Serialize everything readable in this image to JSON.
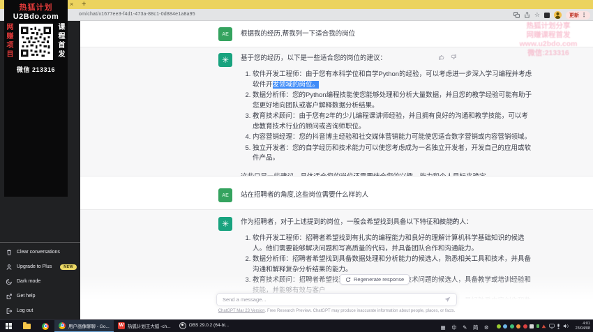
{
  "colors": {
    "tab_strip_yellow": "#ecd35f",
    "brand_green": "#19a37f",
    "selection_highlight_blue": "#3f8cf8",
    "overlay_red": "#e03a3a",
    "new_badge_yellow": "#ecd966"
  },
  "browser": {
    "tab_close_glyph": "×",
    "new_tab_glyph": "+",
    "url": "om/chat/x1677ee3-f4d1-473a-88c1-0d884e1a8a95",
    "bookmark_star_glyph": "☆",
    "update_label": "更新",
    "menu_glyph": "⋮"
  },
  "overlay": {
    "title_line1": "热狐计划",
    "title_line2": "U2Bdo.com",
    "left_vertical": "网赚项目",
    "right_vertical": "课程首发",
    "wechat_label": "微信 213316"
  },
  "watermark": {
    "line1": "热狐计划分享",
    "line2": "网赚课程首发",
    "line3": "www.u2bdo.com",
    "line4": "微信:213316"
  },
  "sidebar": {
    "items": [
      {
        "label": "Clear conversations"
      },
      {
        "label": "Upgrade to Plus",
        "badge": "NEW"
      },
      {
        "label": "Dark mode"
      },
      {
        "label": "Get help"
      },
      {
        "label": "Log out"
      }
    ]
  },
  "chat": {
    "user_avatar_initials": "AE",
    "user1_text": "根据我的经历,帮我列一下适合我的岗位",
    "assistant1": {
      "intro": "基于您的经历，以下是一些适合您的岗位的建议：",
      "items": [
        {
          "pre": "软件开发工程师：由于您有本科学位和自学Python的经验，可以考虑进一步深入学习编程并考虑软件开",
          "highlight": "发领域的岗位。"
        },
        {
          "text": "数据分析师：您的Python编程技能使您能够处理和分析大量数据，并且您的教学经验可能有助于您更好地向团队或客户解释数据分析结果。"
        },
        {
          "text": "教育技术顾问：由于您有2年的少儿编程课讲师经验，并且拥有良好的沟通和教学技能，可以考虑教育技术行业的顾问或咨询师职位。"
        },
        {
          "text": "内容营销经理：您的抖音博主经验和社交媒体营销能力可能使您适合数字营销或内容营销领域。"
        },
        {
          "text": "独立开发者：您的自学经历和技术能力可以使您考虑成为一名独立开发者，开发自己的应用或软件产品。"
        }
      ],
      "outro": "这些只是一些建议，具体适合您的岗位还需要结合您的兴趣、能力和个人目标来确定。"
    },
    "user2_text": "站在招聘者的角度,这些岗位需要什么样的人",
    "assistant2": {
      "intro": "作为招聘者，对于上述提到的岗位，一般会希望找到具备以下特征和技能的人：",
      "items": [
        {
          "text": "软件开发工程师：招聘者希望找到有扎实的编程能力和良好的理解计算机科学基础知识的候选人。他们需要能够解决问题和写高质量的代码，并具备团队合作和沟通能力。"
        },
        {
          "text": "数据分析师：招聘者希望找到具备数据处理和分析能力的候选人，熟悉相关工具和技术，并具备沟通和解释复杂分析结果的能力。"
        },
        {
          "text": "教育技术顾问：招聘者希望找到能够理解和解决教育技术问题的候选人，具备教学或培训经验和技能，并能够有效与客户"
        },
        {
          "text": "内容营销经理：招聘者希望找到具有营销经验和社交媒体技能的候选人，最好熟悉内容创作和数据分析。"
        }
      ]
    },
    "regenerate_label": "Regenerate response",
    "input_placeholder": "Send a message...",
    "footer_link": "ChatGPT Mar 23 Version",
    "footer_text": ". Free Research Preview. ChatGPT may produce inaccurate information about people, places, or facts."
  },
  "taskbar": {
    "tasks": [
      {
        "label": "用户画像聊聊 - Go..."
      },
      {
        "label": "热狐计划王大狐 -ch..."
      },
      {
        "label": "OBS 29.0.2 (64-bi..."
      }
    ],
    "ime_glyphs": [
      "▦",
      "中",
      "✎",
      "简",
      "⚙"
    ],
    "clock_time": "4:01",
    "clock_date": "23/04/08"
  }
}
